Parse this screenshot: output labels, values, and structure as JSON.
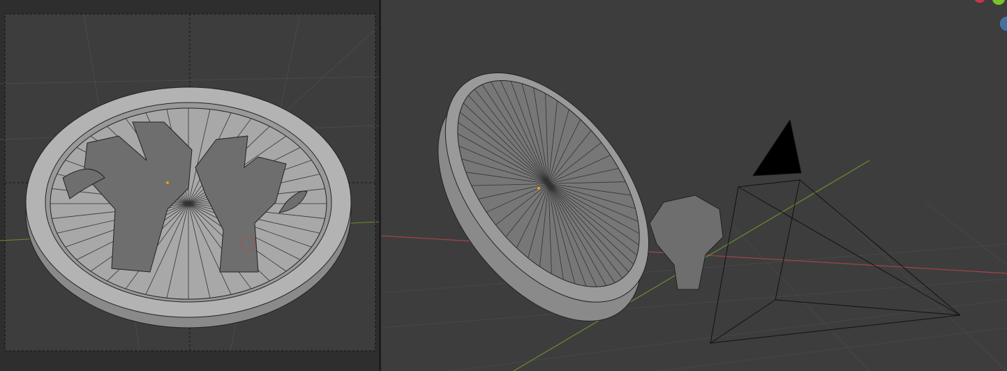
{
  "viewports": {
    "camera_view": {
      "mode": "camera-perspective",
      "objects": [
        "coin",
        "horn-left",
        "horn-right",
        "3d-cursor"
      ]
    },
    "perspective_view": {
      "mode": "user-perspective",
      "objects": [
        "coin",
        "horn",
        "camera",
        "3d-cursor"
      ]
    }
  },
  "gizmo": {
    "x_color": "#d4344a",
    "y_color": "#7ac22a",
    "z_color": "#3e6fb8"
  },
  "colors": {
    "background": "#3d3d3d",
    "grid": "#4a4a4a",
    "x_axis": "#a8424d",
    "y_axis": "#6b8f2a",
    "separator": "#1d1d1d"
  }
}
